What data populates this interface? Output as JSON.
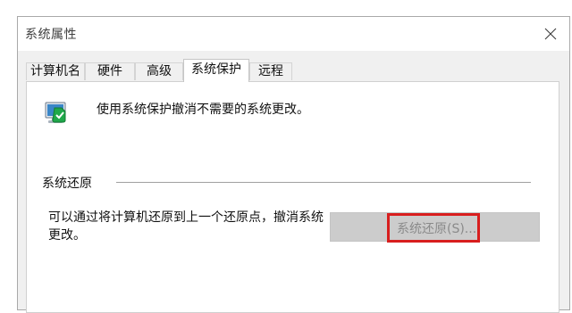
{
  "window": {
    "title": "系统属性"
  },
  "tabs": [
    {
      "label": "计算机名",
      "active": false
    },
    {
      "label": "硬件",
      "active": false
    },
    {
      "label": "高级",
      "active": false
    },
    {
      "label": "系统保护",
      "active": true
    },
    {
      "label": "远程",
      "active": false
    }
  ],
  "protection": {
    "description": "使用系统保护撤消不需要的系统更改。",
    "icon": "system-protection-icon"
  },
  "restore": {
    "group_label": "系统还原",
    "text": "可以通过将计算机还原到上一个还原点，撤消系统更改。",
    "button_label": "系统还原(S)...",
    "button_enabled": false,
    "highlight_color": "#d81e1e"
  }
}
